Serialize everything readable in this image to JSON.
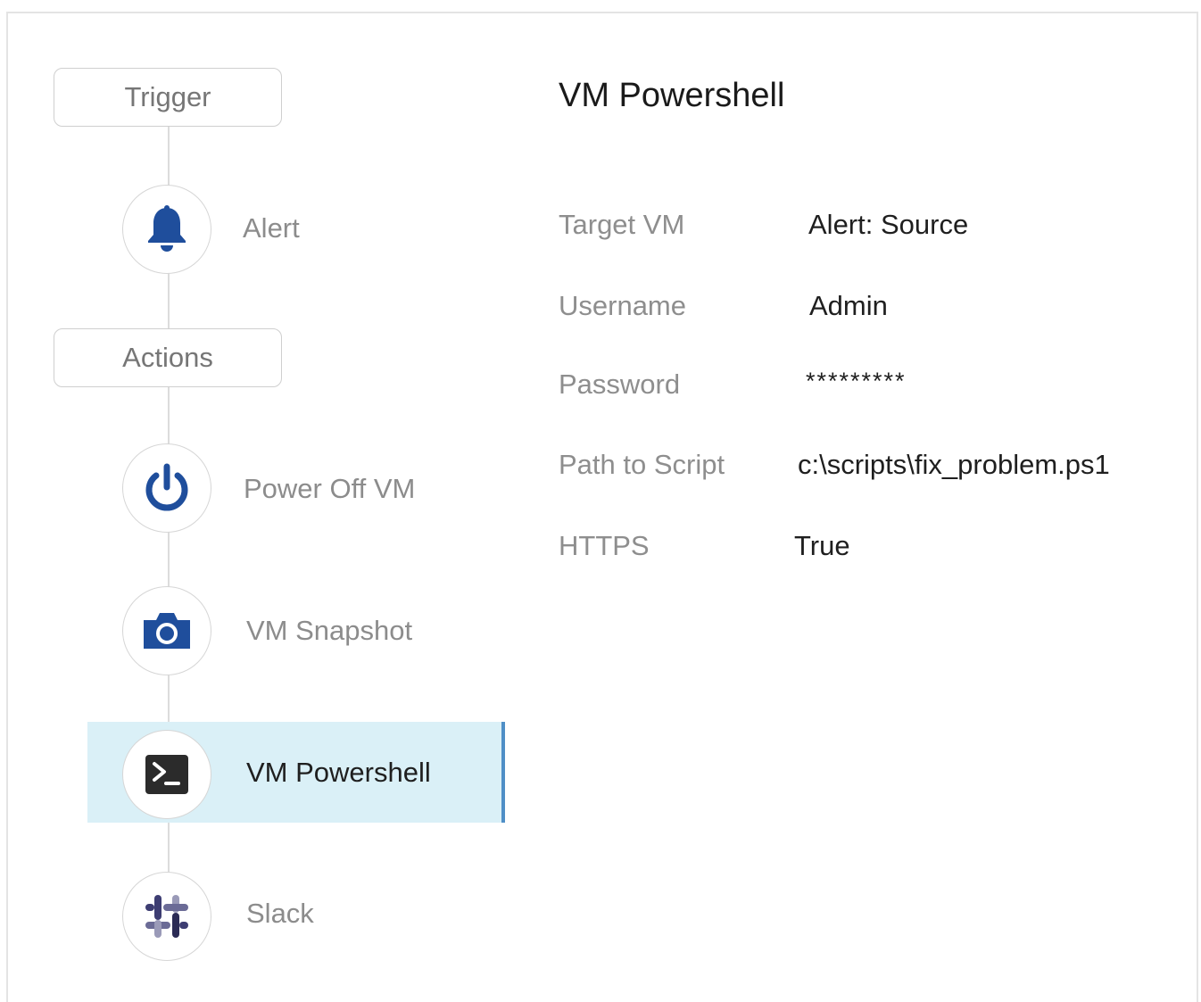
{
  "workflow": {
    "trigger_label": "Trigger",
    "actions_label": "Actions",
    "steps": [
      {
        "label": "Alert",
        "icon": "bell-icon"
      },
      {
        "label": "Power Off VM",
        "icon": "power-icon"
      },
      {
        "label": "VM Snapshot",
        "icon": "camera-icon"
      },
      {
        "label": "VM Powershell",
        "icon": "powershell-icon",
        "selected": true
      },
      {
        "label": "Slack",
        "icon": "slack-icon"
      }
    ]
  },
  "details": {
    "title": "VM Powershell",
    "fields": [
      {
        "label": "Target VM",
        "value": "Alert: Source"
      },
      {
        "label": "Username",
        "value": "Admin"
      },
      {
        "label": "Password",
        "value": "*********"
      },
      {
        "label": "Path to Script",
        "value": "c:\\scripts\\fix_problem.ps1"
      },
      {
        "label": "HTTPS",
        "value": "True"
      }
    ]
  },
  "colors": {
    "accent": "#1f4e9c",
    "selected_bg": "#daf0f7",
    "selected_border": "#4f8fc7"
  }
}
